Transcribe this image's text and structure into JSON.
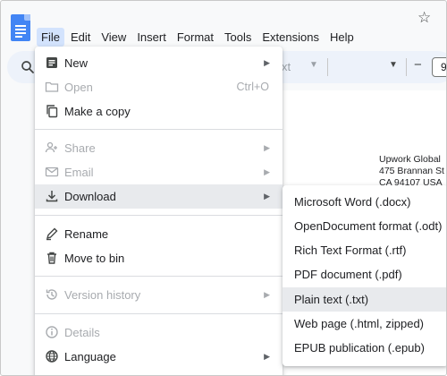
{
  "menubar": {
    "items": [
      "File",
      "Edit",
      "View",
      "Insert",
      "Format",
      "Tools",
      "Extensions",
      "Help"
    ],
    "active": "File"
  },
  "toolbar": {
    "font_partial": "xt",
    "font_size": "9"
  },
  "document": {
    "address_lines": [
      "Upwork Global",
      "475 Brannan St",
      "CA 94107 USA"
    ]
  },
  "file_menu": {
    "new": "New",
    "open": "Open",
    "open_shortcut": "Ctrl+O",
    "make_copy": "Make a copy",
    "share": "Share",
    "email": "Email",
    "download": "Download",
    "rename": "Rename",
    "move_to_bin": "Move to bin",
    "version_history": "Version history",
    "details": "Details",
    "language": "Language"
  },
  "download_submenu": {
    "items": [
      "Microsoft Word (.docx)",
      "OpenDocument format (.odt)",
      "Rich Text Format (.rtf)",
      "PDF document (.pdf)",
      "Plain text (.txt)",
      "Web page (.html, zipped)",
      "EPUB publication (.epub)"
    ],
    "hovered": "Plain text (.txt)"
  },
  "colors": {
    "brand_blue": "#4285f4",
    "active_menu_bg": "#d3e3fd",
    "hover_bg": "#e8eaed",
    "disabled_text": "#a8abaf"
  }
}
